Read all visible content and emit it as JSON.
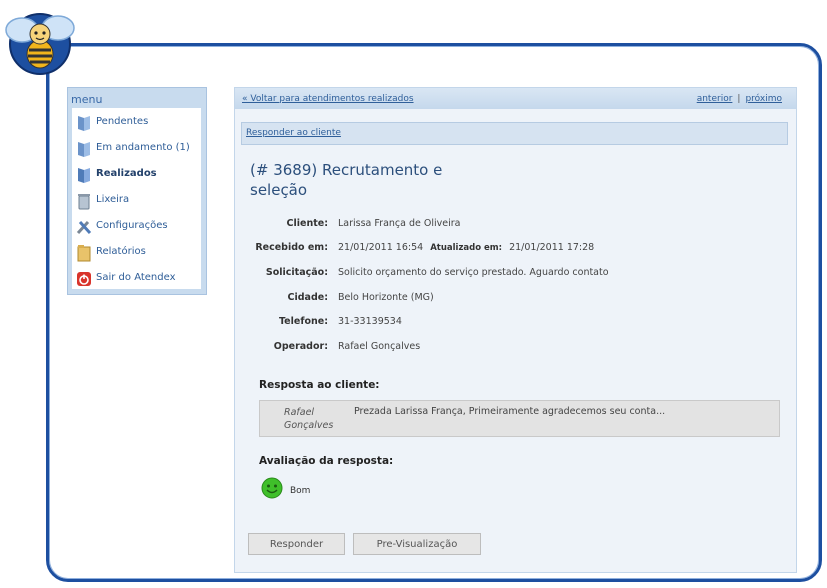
{
  "menu": {
    "title": "menu",
    "items": [
      {
        "label": "Pendentes"
      },
      {
        "label": "Em andamento (1)"
      },
      {
        "label": "Realizados"
      },
      {
        "label": "Lixeira"
      },
      {
        "label": "Configurações"
      },
      {
        "label": "Relatórios"
      },
      {
        "label": "Sair do Atendex"
      }
    ]
  },
  "topbar": {
    "back": "« Voltar para atendimentos realizados",
    "prev": "anterior",
    "sep": "|",
    "next": "próximo"
  },
  "reply_link": "Responder ao cliente",
  "ticket": {
    "title": "(# 3689) Recrutamento e seleção",
    "fields": {
      "cliente_label": "Cliente:",
      "cliente": "Larissa França de Oliveira",
      "recebido_label": "Recebido em:",
      "recebido": "21/01/2011 16:54",
      "atualizado_label": "Atualizado em:",
      "atualizado": "21/01/2011 17:28",
      "solicitacao_label": "Solicitação:",
      "solicitacao": "Solicito orçamento do serviço prestado. Aguardo contato",
      "cidade_label": "Cidade:",
      "cidade": "Belo Horizonte (MG)",
      "telefone_label": "Telefone:",
      "telefone": "31-33139534",
      "operador_label": "Operador:",
      "operador": "Rafael Gonçalves"
    }
  },
  "response": {
    "heading": "Resposta ao cliente:",
    "author": "Rafael Gonçalves",
    "text": "Prezada Larissa França, Primeiramente agradecemos seu conta..."
  },
  "rating": {
    "heading": "Avaliação da resposta:",
    "label": "Bom",
    "color": "#3fbf2a"
  },
  "buttons": {
    "responder": "Responder",
    "preview": "Pre-Visualização"
  },
  "colors": {
    "frame": "#1d4fa0",
    "accent": "#2f5f9a"
  }
}
